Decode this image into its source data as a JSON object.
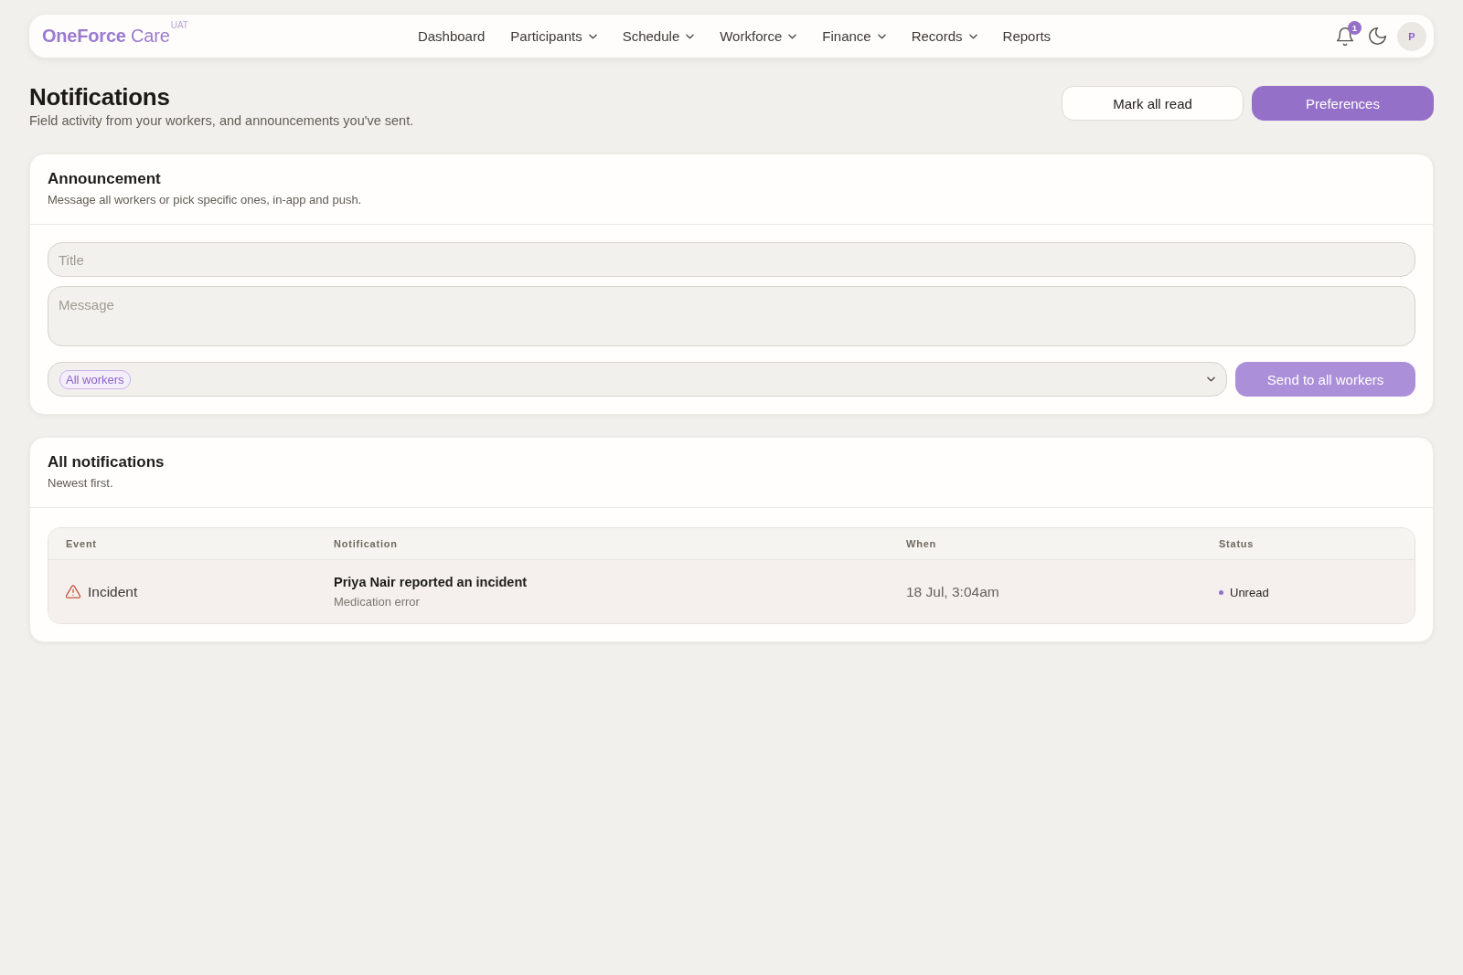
{
  "header": {
    "logo": "**OneForce** Care",
    "environment": "UAT",
    "nav": [
      {
        "label": "Dashboard",
        "has_menu": false
      },
      {
        "label": "Participants",
        "has_menu": true
      },
      {
        "label": "Schedule",
        "has_menu": true
      },
      {
        "label": "Workforce",
        "has_menu": true
      },
      {
        "label": "Finance",
        "has_menu": true
      },
      {
        "label": "Records",
        "has_menu": true
      },
      {
        "label": "Reports",
        "has_menu": false
      }
    ],
    "notification_count": "1",
    "avatar_initial": "P"
  },
  "page": {
    "title": "Notifications",
    "subtitle": "Field activity from your workers, and announcements you've sent.",
    "actions": [
      {
        "label": "Mark all read",
        "kind": "secondary"
      },
      {
        "label": "Preferences",
        "kind": "primary"
      }
    ]
  },
  "announcement": {
    "title": "Announcement",
    "subtitle": "Message all workers or pick specific ones, in-app and push.",
    "title_field": {
      "placeholder": "Title"
    },
    "message_field": {
      "placeholder": "Message"
    },
    "recipients": {
      "chips": [
        "All workers"
      ]
    },
    "send_button": {
      "label": "Send to all workers",
      "disabled": true
    }
  },
  "notifications": {
    "title": "All notifications",
    "subtitle": "Newest first.",
    "columns": [
      "Event",
      "Notification",
      "When",
      "Status"
    ],
    "rows": [
      {
        "event": {
          "kind": "incident",
          "label": "Incident"
        },
        "title": "Priya Nair reported an incident",
        "detail": "Medication error",
        "when": "18 Jul, 3:04am",
        "status": "Unread",
        "unread": true
      }
    ]
  }
}
